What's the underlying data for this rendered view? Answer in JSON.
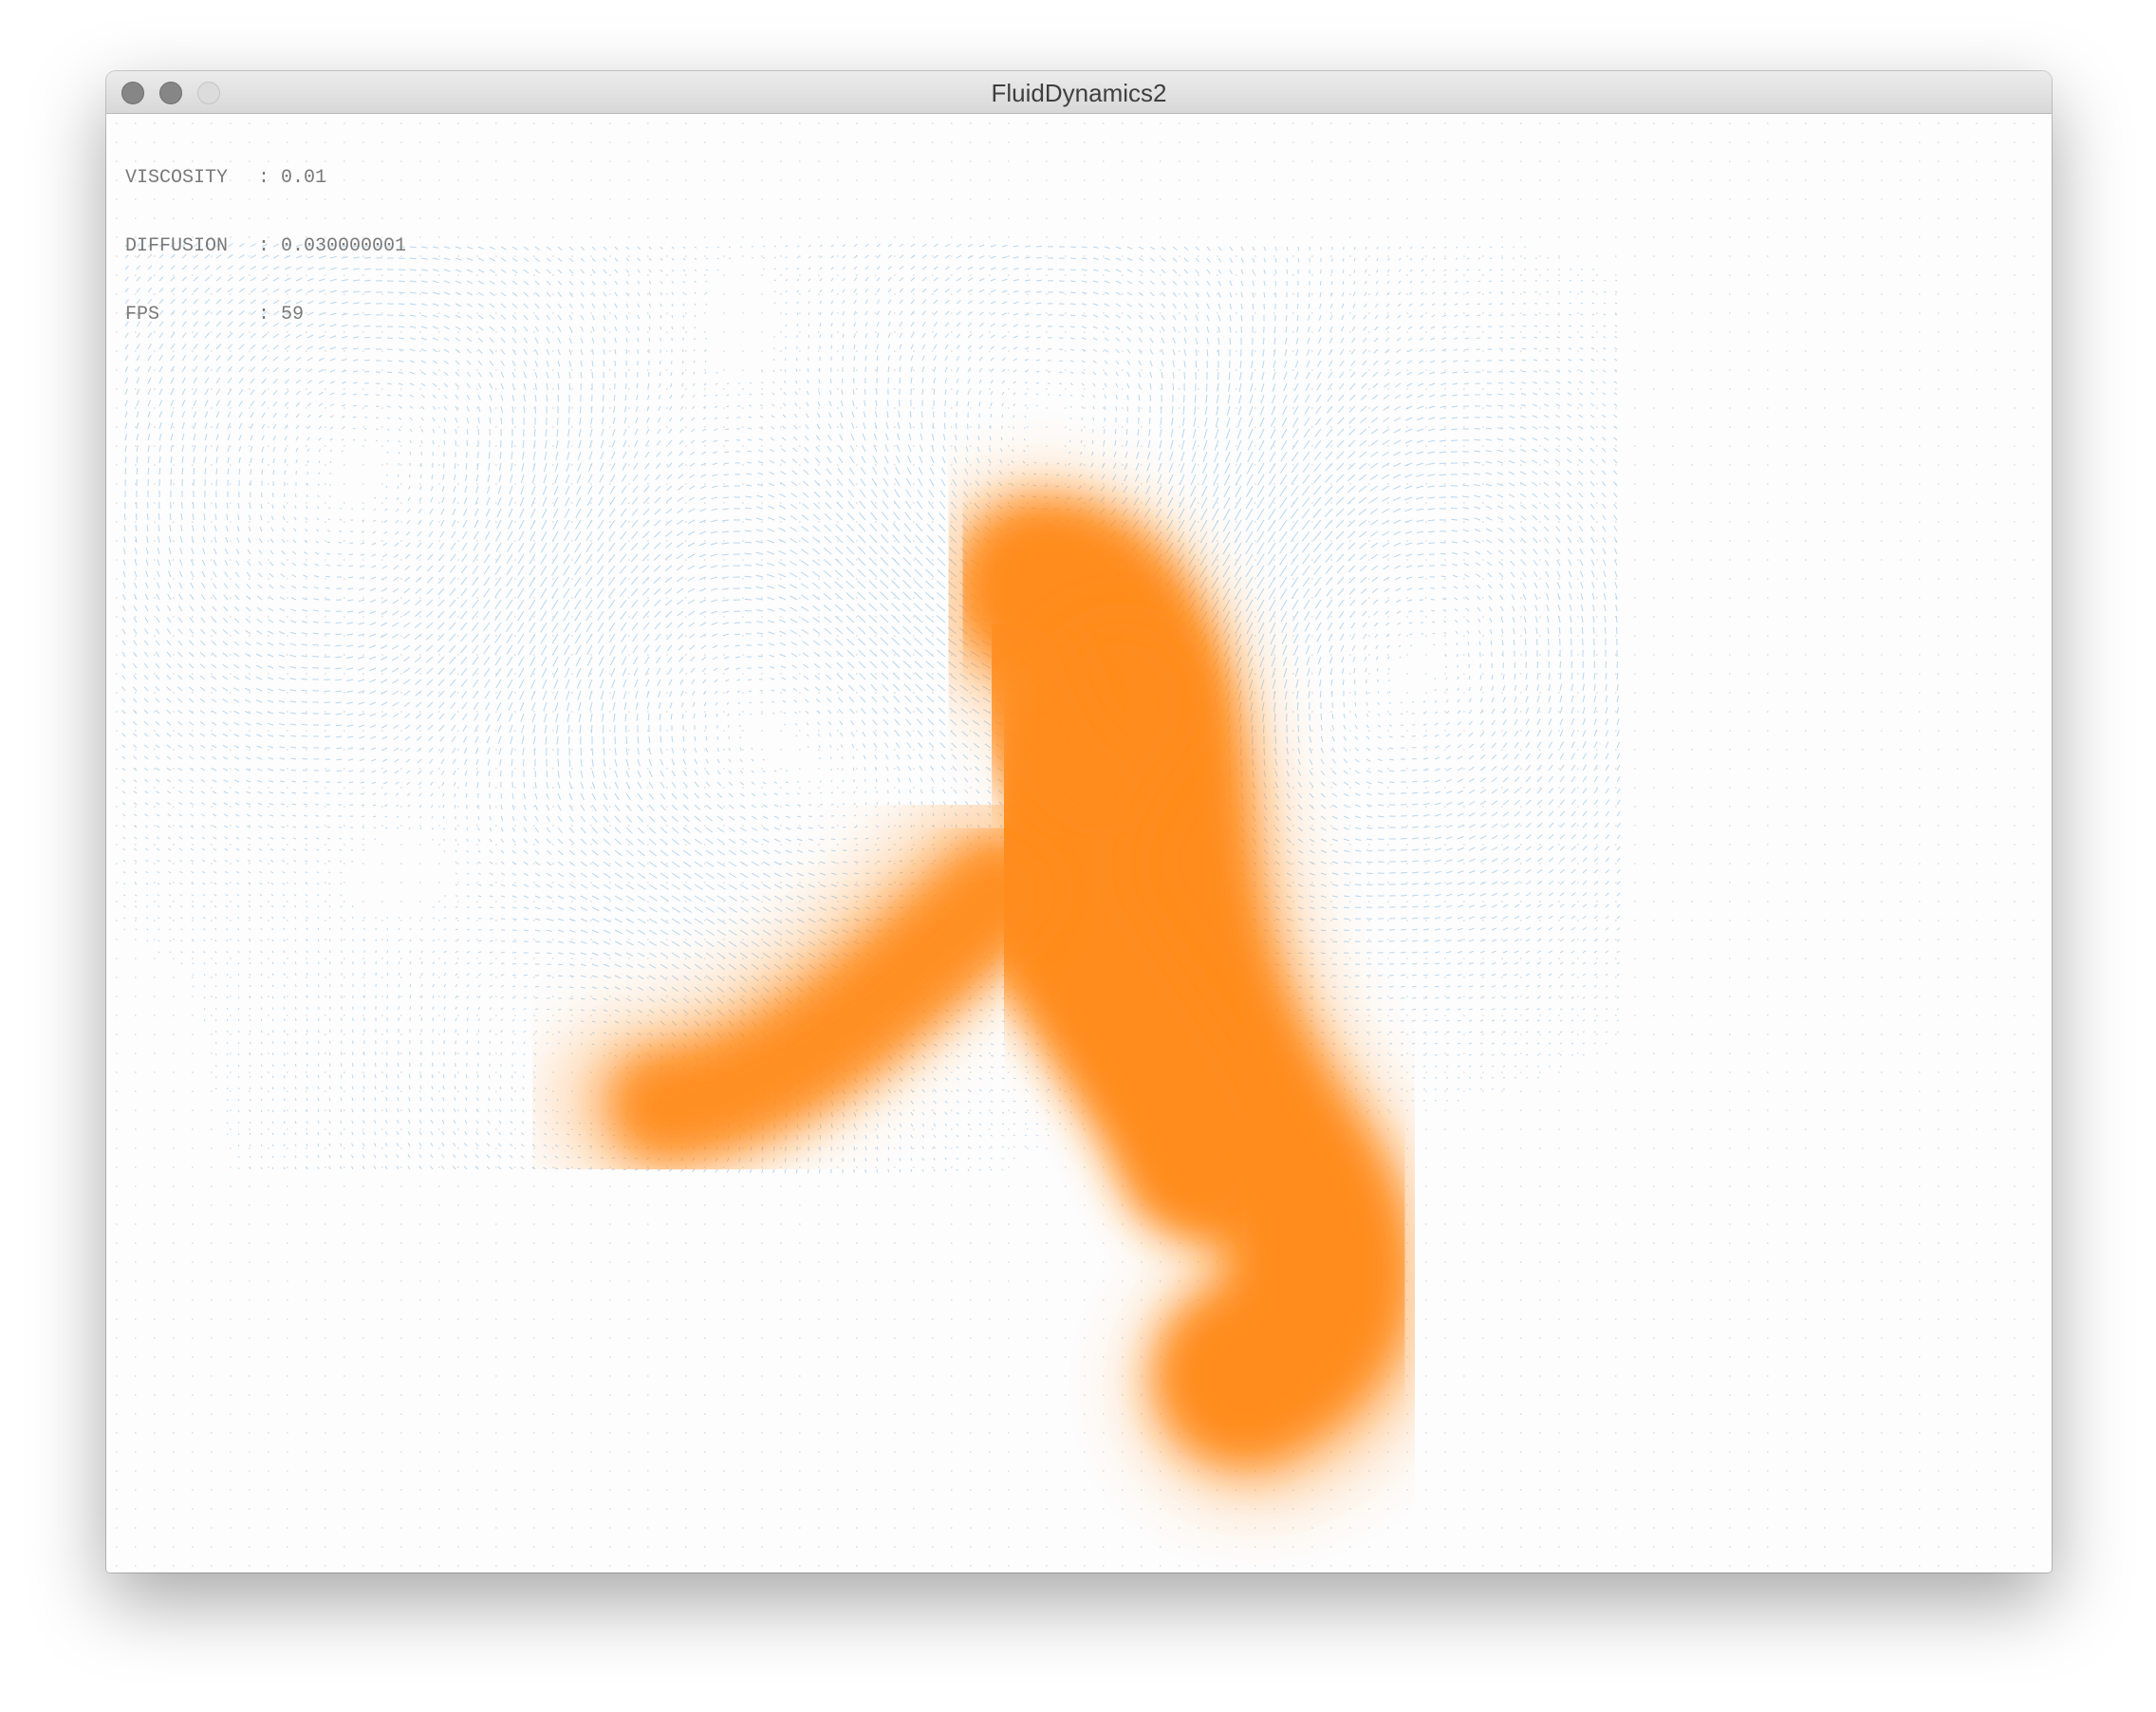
{
  "window": {
    "title": "FluidDynamics2"
  },
  "hud": {
    "rows": [
      {
        "label": "VISCOSITY",
        "value": ": 0.01"
      },
      {
        "label": "DIFFUSION",
        "value": ": 0.030000001"
      },
      {
        "label": "FPS",
        "value": ": 59"
      }
    ]
  },
  "colors": {
    "dye": "#ff8c1e",
    "velocity_vectors": "#9fc9ec",
    "grid_dots": "#c8c8c8",
    "background": "#fdfdfd"
  }
}
